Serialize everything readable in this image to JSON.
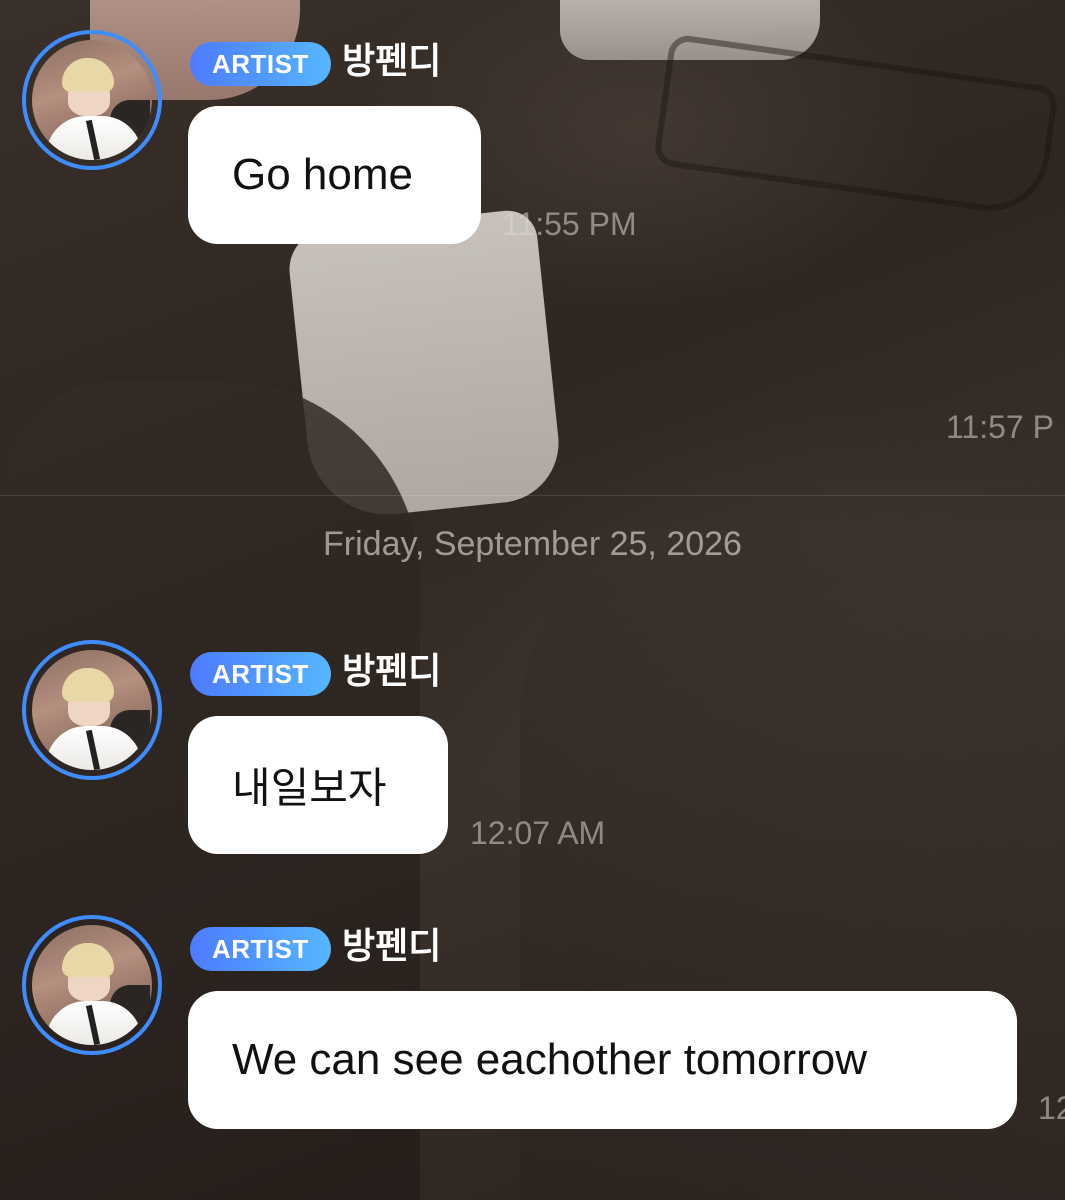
{
  "messages": [
    {
      "badge": "ARTIST",
      "sender": "방펜디",
      "text": "Go home",
      "time": "11:55 PM"
    },
    {
      "badge": "ARTIST",
      "sender": "방펜디",
      "text": "내일보자",
      "time": "12:07 AM"
    },
    {
      "badge": "ARTIST",
      "sender": "방펜디",
      "text": "We can see eachother tomorrow",
      "time": "12"
    }
  ],
  "other_time": "11:57 P",
  "date_separator": "Friday, September 25, 2026",
  "colors": {
    "badge_gradient_start": "#4d7bff",
    "badge_gradient_end": "#56b6ff",
    "avatar_ring": "#3f8cff",
    "bubble_bg": "#ffffff",
    "timestamp": "#dcd6d2"
  },
  "icons": {
    "avatar": "artist-avatar-photo"
  }
}
